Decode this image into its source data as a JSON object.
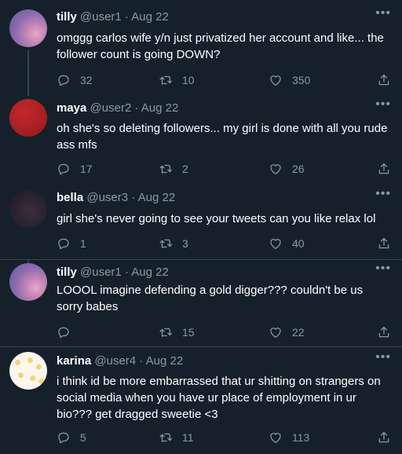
{
  "tweets": [
    {
      "name": "tilly",
      "handle": "@user1",
      "date": "· Aug 22",
      "text": "omggg carlos wife y/n just privatized her account and like... the follower count is going DOWN?",
      "replies": "32",
      "retweets": "10",
      "likes": "350"
    },
    {
      "name": "maya",
      "handle": "@user2",
      "date": "· Aug 22",
      "text": "oh she's so deleting followers... my girl is done with all you rude ass mfs",
      "replies": "17",
      "retweets": "2",
      "likes": "26"
    },
    {
      "name": "bella",
      "handle": "@user3",
      "date": "· Aug 22",
      "text": "girl she's never going to see your tweets can you like relax lol",
      "replies": "1",
      "retweets": "3",
      "likes": "40"
    },
    {
      "name": "tilly",
      "handle": "@user1",
      "date": "· Aug 22",
      "text": "LOOOL imagine defending a gold digger??? couldn't be us sorry babes",
      "replies": "",
      "retweets": "15",
      "likes": "22"
    },
    {
      "name": "karina",
      "handle": "@user4",
      "date": "· Aug 22",
      "text": "i think id be more embarrassed that ur shitting on strangers on social media when you have ur place of employment in ur bio??? get dragged sweetie <3",
      "replies": "5",
      "retweets": "11",
      "likes": "113"
    }
  ],
  "icons": {
    "more": "more-icon",
    "reply": "reply-icon",
    "retweet": "retweet-icon",
    "like": "like-icon",
    "share": "share-icon"
  },
  "colors": {
    "background": "#15202b",
    "text": "#ffffff",
    "secondary": "#8899a6",
    "divider": "#38444d"
  }
}
